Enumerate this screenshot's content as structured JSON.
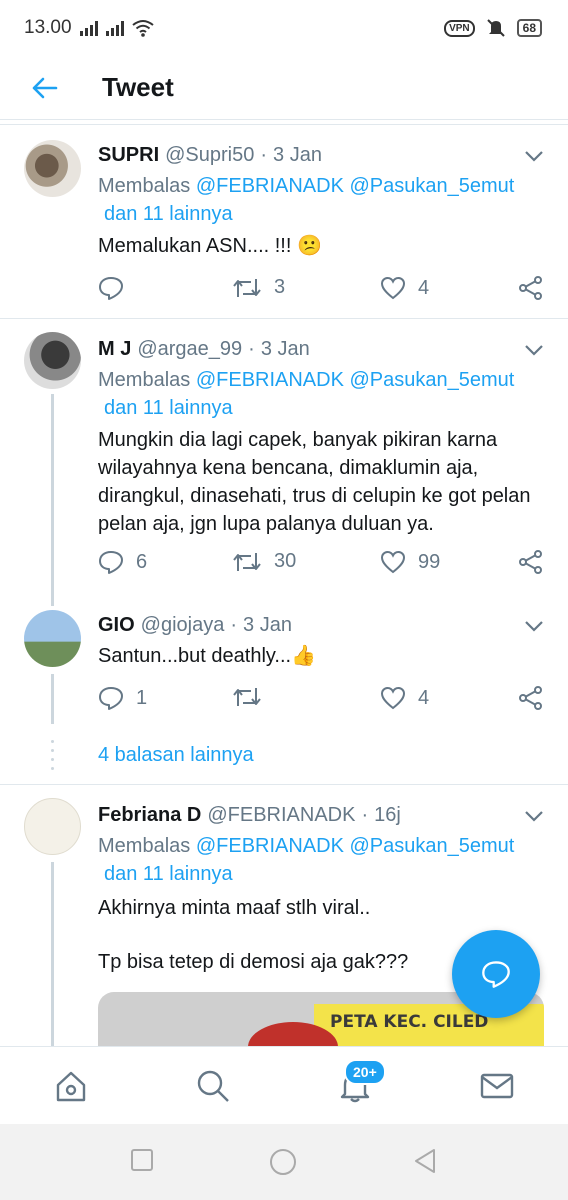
{
  "status_bar": {
    "time": "13.00",
    "vpn": "VPN",
    "battery": "68"
  },
  "header": {
    "title": "Tweet"
  },
  "tweets": [
    {
      "name": "SUPRI",
      "handle": "@Supri50",
      "dot": "·",
      "time": "3 Jan",
      "reply_prefix": "Membalas",
      "mention1": "@FEBRIANADK",
      "mention2": "@Pasukan_5emut",
      "others": "dan 11 lainnya",
      "text": "Memalukan ASN.... !!! 😕",
      "replies": "",
      "retweets": "3",
      "likes": "4"
    },
    {
      "name": "M J",
      "handle": "@argae_99",
      "dot": "·",
      "time": "3 Jan",
      "reply_prefix": "Membalas",
      "mention1": "@FEBRIANADK",
      "mention2": "@Pasukan_5emut",
      "others": "dan 11 lainnya",
      "text": "Mungkin dia lagi capek, banyak pikiran karna wilayahnya kena bencana, dimaklumin aja, dirangkul, dinasehati, trus di celupin ke got pelan pelan aja, jgn lupa palanya duluan ya.",
      "replies": "6",
      "retweets": "30",
      "likes": "99"
    },
    {
      "name": "GIO",
      "handle": "@giojaya",
      "dot": "·",
      "time": "3 Jan",
      "text": "Santun...but deathly...👍",
      "replies": "1",
      "retweets": "",
      "likes": "4"
    },
    {
      "name": "Febriana D",
      "handle": "@FEBRIANADK",
      "dot": "·",
      "time": "16j",
      "reply_prefix": "Membalas",
      "mention1": "@FEBRIANADK",
      "mention2": "@Pasukan_5emut",
      "others": "dan 11 lainnya",
      "text1": "Akhirnya minta maaf stlh viral..",
      "text2": "Tp bisa tetep di demosi aja gak???",
      "media_text": "PETA KEC. CILED"
    }
  ],
  "more_replies": "4 balasan lainnya",
  "bottom_nav": {
    "notif_badge": "20+"
  },
  "colors": {
    "accent": "#1da1f2",
    "muted": "#657786",
    "text": "#14171a",
    "divider": "#e1e8ed"
  }
}
